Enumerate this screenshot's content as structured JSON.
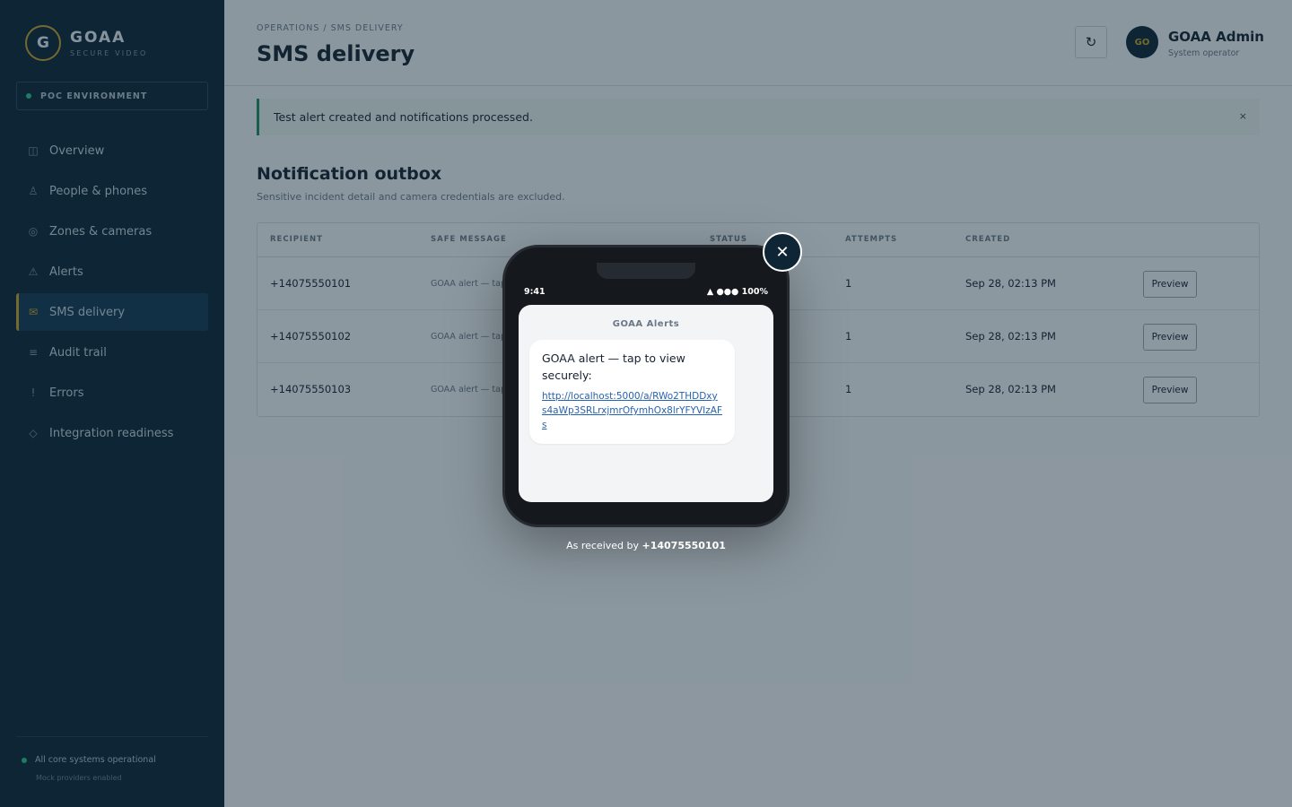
{
  "brand": {
    "name": "GOAA",
    "sub": "SECURE VIDEO",
    "logo_letter": "G"
  },
  "env_badge": "POC ENVIRONMENT",
  "nav": [
    {
      "icon": "◫",
      "label": "Overview",
      "icon_name": "overview-icon"
    },
    {
      "icon": "♙",
      "label": "People & phones",
      "icon_name": "person-icon"
    },
    {
      "icon": "◎",
      "label": "Zones & cameras",
      "icon_name": "camera-icon"
    },
    {
      "icon": "⚠",
      "label": "Alerts",
      "icon_name": "warning-icon"
    },
    {
      "icon": "✉",
      "label": "SMS delivery",
      "icon_name": "mail-icon",
      "active": true
    },
    {
      "icon": "≡",
      "label": "Audit trail",
      "icon_name": "list-icon"
    },
    {
      "icon": "!",
      "label": "Errors",
      "icon_name": "error-icon"
    },
    {
      "icon": "◇",
      "label": "Integration readiness",
      "icon_name": "diamond-icon"
    }
  ],
  "footer": {
    "status": "All core systems operational",
    "sub": "Mock providers enabled"
  },
  "header": {
    "breadcrumb": "OPERATIONS / SMS DELIVERY",
    "title": "SMS delivery",
    "refresh_icon": "↻",
    "user": {
      "initials": "GO",
      "name": "GOAA Admin",
      "role": "System operator"
    }
  },
  "banner": {
    "text": "Test alert created and notifications processed.",
    "close": "×"
  },
  "section": {
    "title": "Notification outbox",
    "subtitle": "Sensitive incident detail and camera credentials are excluded."
  },
  "table": {
    "columns": [
      "RECIPIENT",
      "SAFE MESSAGE",
      "STATUS",
      "ATTEMPTS",
      "CREATED"
    ],
    "rows": [
      {
        "recipient": "+14075550101",
        "message": "GOAA alert — tap",
        "attempts": "1",
        "created": "Sep 28, 02:13 PM",
        "action": "Preview"
      },
      {
        "recipient": "+14075550102",
        "message": "GOAA alert — tap",
        "attempts": "1",
        "created": "Sep 28, 02:13 PM",
        "action": "Preview"
      },
      {
        "recipient": "+14075550103",
        "message": "GOAA alert — tap",
        "attempts": "1",
        "created": "Sep 28, 02:13 PM",
        "action": "Preview"
      }
    ]
  },
  "modal": {
    "close_icon": "✕",
    "phone": {
      "time": "9:41",
      "status": "▲ ●●● 100%",
      "sender": "GOAA Alerts",
      "message": "GOAA alert — tap to view securely:",
      "link": "http://localhost:5000/a/RWo2THDDxys4aWp3SRLrxjmrOfymhOx8lrYFYVIzAFs"
    },
    "caption_prefix": "As received by ",
    "caption_number": "+14075550101"
  }
}
